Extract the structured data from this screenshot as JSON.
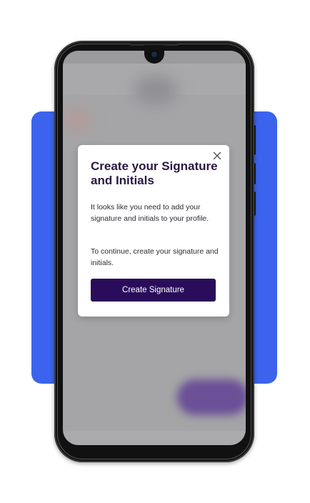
{
  "dialog": {
    "title": "Create your Signature and Initials",
    "body_1": "It looks like you need to add your signature and initials to your profile.",
    "body_2": "To continue, create your signature and initials.",
    "primary_button": "Create Signature",
    "close_icon": "close-icon"
  },
  "colors": {
    "backdrop": "#3b63ee",
    "primary_button": "#2a0d5a",
    "title_text": "#2a1840",
    "scrim": "#a5a5a7"
  }
}
